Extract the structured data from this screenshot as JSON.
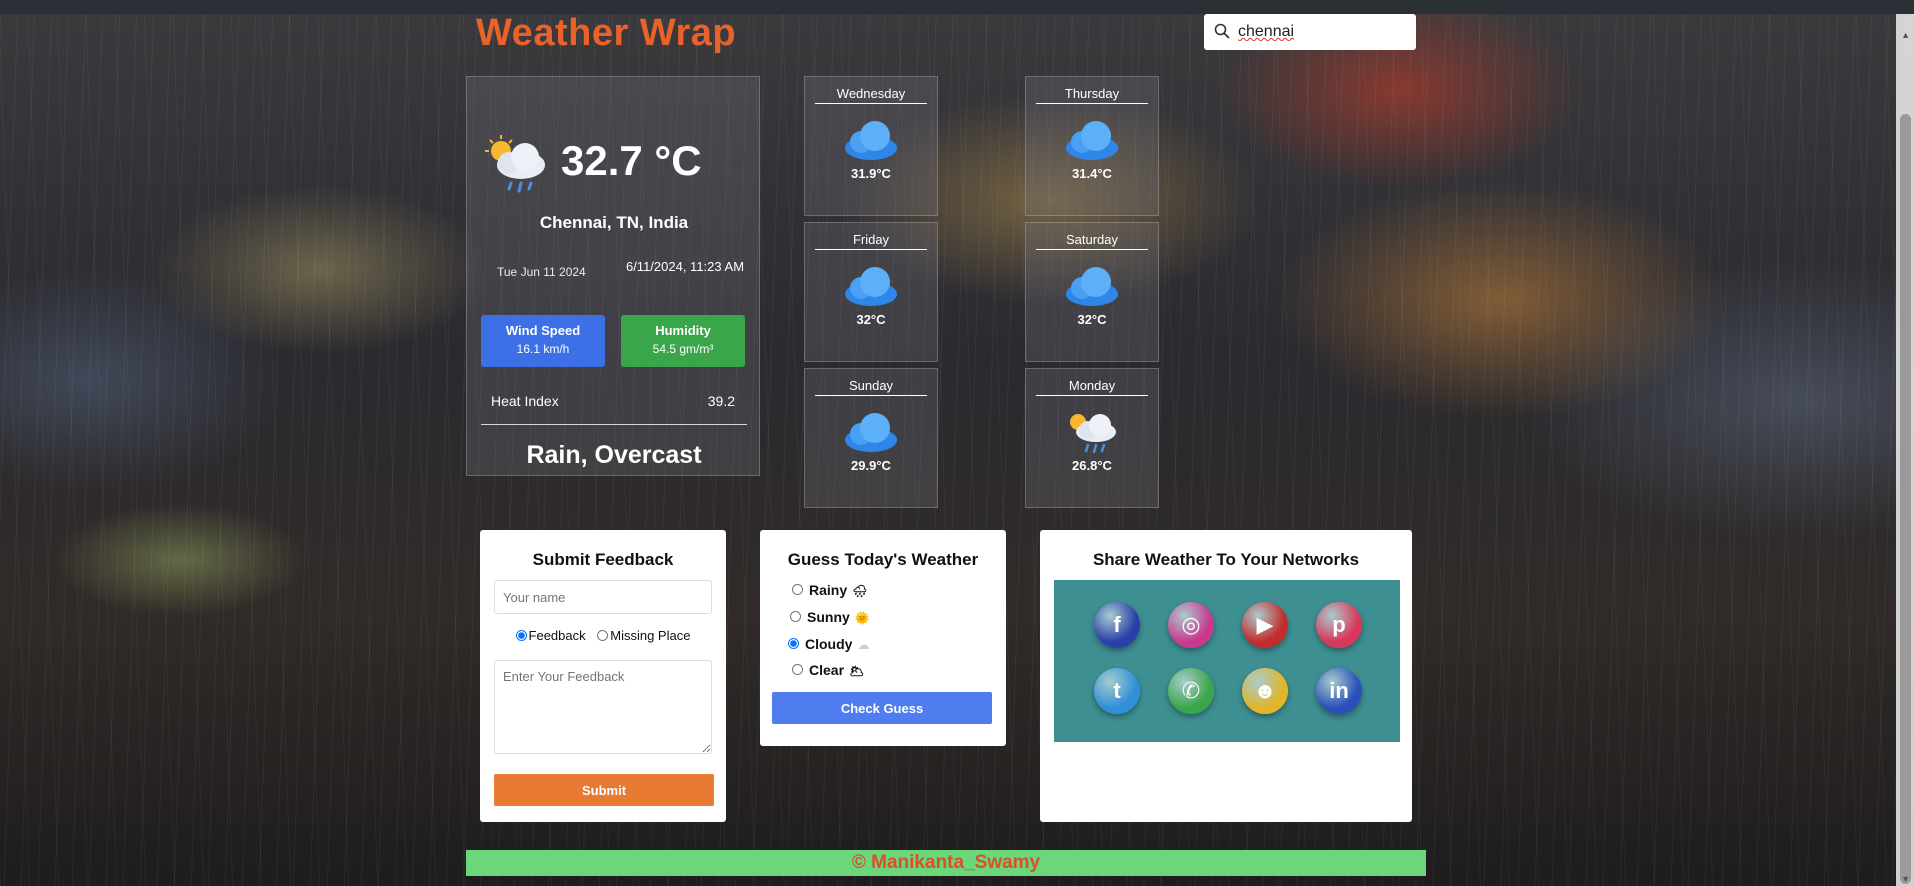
{
  "app": {
    "title": "Weather Wrap"
  },
  "search": {
    "value": "chennai",
    "placeholder": ""
  },
  "current": {
    "temperature": "32.7 °C",
    "location": "Chennai, TN, India",
    "date": "Tue Jun 11 2024",
    "datetime": "6/11/2024, 11:23 AM",
    "wind_label": "Wind Speed",
    "wind_value": "16.1 km/h",
    "humidity_label": "Humidity",
    "humidity_value": "54.5 gm/m³",
    "heat_label": "Heat Index",
    "heat_value": "39.2",
    "condition": "Rain, Overcast",
    "icon": "sun-cloud-rain-icon"
  },
  "forecast": [
    {
      "day": "Wednesday",
      "temp": "31.9°C",
      "icon": "cloud-icon"
    },
    {
      "day": "Thursday",
      "temp": "31.4°C",
      "icon": "cloud-icon"
    },
    {
      "day": "Friday",
      "temp": "32°C",
      "icon": "cloud-icon"
    },
    {
      "day": "Saturday",
      "temp": "32°C",
      "icon": "cloud-icon"
    },
    {
      "day": "Sunday",
      "temp": "29.9°C",
      "icon": "cloud-icon"
    },
    {
      "day": "Monday",
      "temp": "26.8°C",
      "icon": "sun-cloud-rain-icon"
    }
  ],
  "feedback": {
    "title": "Submit Feedback",
    "name_placeholder": "Your name",
    "radio_feedback": "Feedback",
    "radio_missing": "Missing Place",
    "selected": "Feedback",
    "textarea_placeholder": "Enter Your Feedback",
    "submit_label": "Submit"
  },
  "guess": {
    "title": "Guess Today's Weather",
    "options": [
      {
        "label": "Rainy",
        "emoji": "🌧",
        "checked": false
      },
      {
        "label": "Sunny",
        "emoji": "🌞",
        "checked": false
      },
      {
        "label": "Cloudy",
        "emoji": "☁",
        "checked": true
      },
      {
        "label": "Clear",
        "emoji": "🌥",
        "checked": false
      }
    ],
    "button_label": "Check Guess"
  },
  "share": {
    "title": "Share Weather To Your Networks",
    "networks": [
      {
        "name": "facebook",
        "glyph": "f",
        "color": "#2a3fa8"
      },
      {
        "name": "instagram",
        "glyph": "◎",
        "color": "#c93a8e"
      },
      {
        "name": "youtube",
        "glyph": "▶",
        "color": "#c42b2b"
      },
      {
        "name": "pinterest",
        "glyph": "p",
        "color": "#d8385a"
      },
      {
        "name": "twitter",
        "glyph": "t",
        "color": "#2f8fd8"
      },
      {
        "name": "whatsapp",
        "glyph": "✆",
        "color": "#3aa64a"
      },
      {
        "name": "snapchat",
        "glyph": "☻",
        "color": "#e0b52a"
      },
      {
        "name": "linkedin",
        "glyph": "in",
        "color": "#2b4fb8"
      }
    ]
  },
  "footer": {
    "text": "© Manikanta_Swamy"
  }
}
